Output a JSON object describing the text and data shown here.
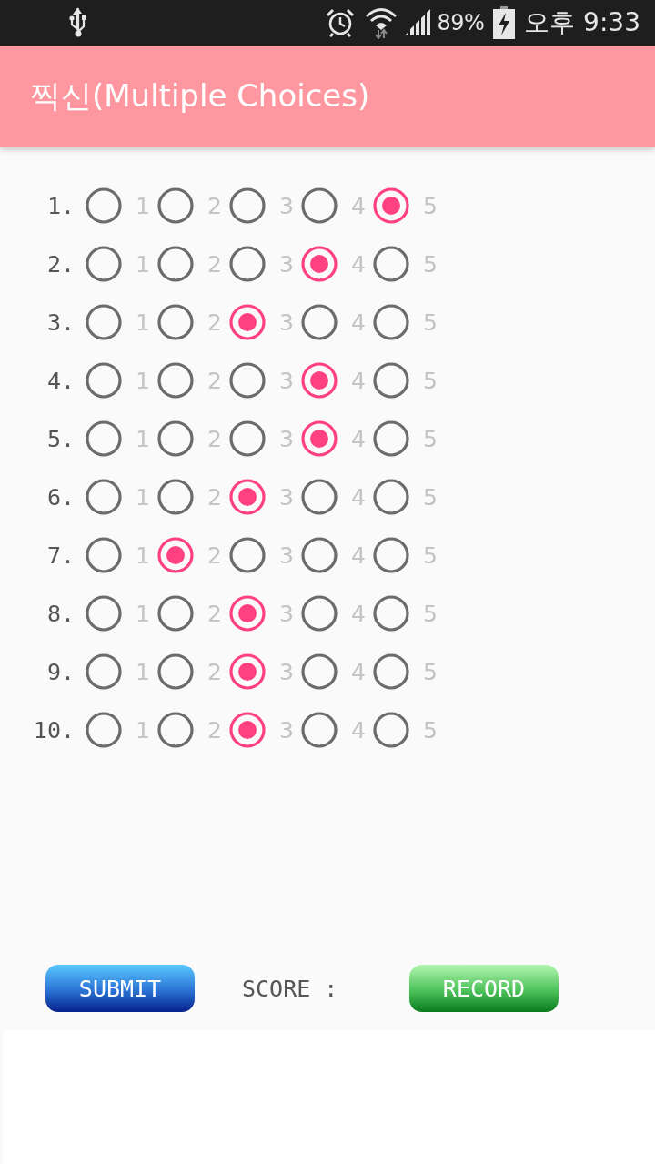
{
  "status_bar": {
    "battery": "89%",
    "time": "오후 9:33"
  },
  "app_bar": {
    "title": "찍신(Multiple Choices)"
  },
  "questions": [
    {
      "number": "1.",
      "options": [
        {
          "label": "1",
          "selected": false
        },
        {
          "label": "2",
          "selected": false
        },
        {
          "label": "3",
          "selected": false
        },
        {
          "label": "4",
          "selected": false
        },
        {
          "label": "5",
          "selected": true
        }
      ]
    },
    {
      "number": "2.",
      "options": [
        {
          "label": "1",
          "selected": false
        },
        {
          "label": "2",
          "selected": false
        },
        {
          "label": "3",
          "selected": false
        },
        {
          "label": "4",
          "selected": true
        },
        {
          "label": "5",
          "selected": false
        }
      ]
    },
    {
      "number": "3.",
      "options": [
        {
          "label": "1",
          "selected": false
        },
        {
          "label": "2",
          "selected": false
        },
        {
          "label": "3",
          "selected": true
        },
        {
          "label": "4",
          "selected": false
        },
        {
          "label": "5",
          "selected": false
        }
      ]
    },
    {
      "number": "4.",
      "options": [
        {
          "label": "1",
          "selected": false
        },
        {
          "label": "2",
          "selected": false
        },
        {
          "label": "3",
          "selected": false
        },
        {
          "label": "4",
          "selected": true
        },
        {
          "label": "5",
          "selected": false
        }
      ]
    },
    {
      "number": "5.",
      "options": [
        {
          "label": "1",
          "selected": false
        },
        {
          "label": "2",
          "selected": false
        },
        {
          "label": "3",
          "selected": false
        },
        {
          "label": "4",
          "selected": true
        },
        {
          "label": "5",
          "selected": false
        }
      ]
    },
    {
      "number": "6.",
      "options": [
        {
          "label": "1",
          "selected": false
        },
        {
          "label": "2",
          "selected": false
        },
        {
          "label": "3",
          "selected": true
        },
        {
          "label": "4",
          "selected": false
        },
        {
          "label": "5",
          "selected": false
        }
      ]
    },
    {
      "number": "7.",
      "options": [
        {
          "label": "1",
          "selected": false
        },
        {
          "label": "2",
          "selected": true
        },
        {
          "label": "3",
          "selected": false
        },
        {
          "label": "4",
          "selected": false
        },
        {
          "label": "5",
          "selected": false
        }
      ]
    },
    {
      "number": "8.",
      "options": [
        {
          "label": "1",
          "selected": false
        },
        {
          "label": "2",
          "selected": false
        },
        {
          "label": "3",
          "selected": true
        },
        {
          "label": "4",
          "selected": false
        },
        {
          "label": "5",
          "selected": false
        }
      ]
    },
    {
      "number": "9.",
      "options": [
        {
          "label": "1",
          "selected": false
        },
        {
          "label": "2",
          "selected": false
        },
        {
          "label": "3",
          "selected": true
        },
        {
          "label": "4",
          "selected": false
        },
        {
          "label": "5",
          "selected": false
        }
      ]
    },
    {
      "number": "10.",
      "options": [
        {
          "label": "1",
          "selected": false
        },
        {
          "label": "2",
          "selected": false
        },
        {
          "label": "3",
          "selected": true
        },
        {
          "label": "4",
          "selected": false
        },
        {
          "label": "5",
          "selected": false
        }
      ]
    }
  ],
  "actions": {
    "submit": "SUBMIT",
    "score_label": "SCORE :",
    "record": "RECORD"
  }
}
